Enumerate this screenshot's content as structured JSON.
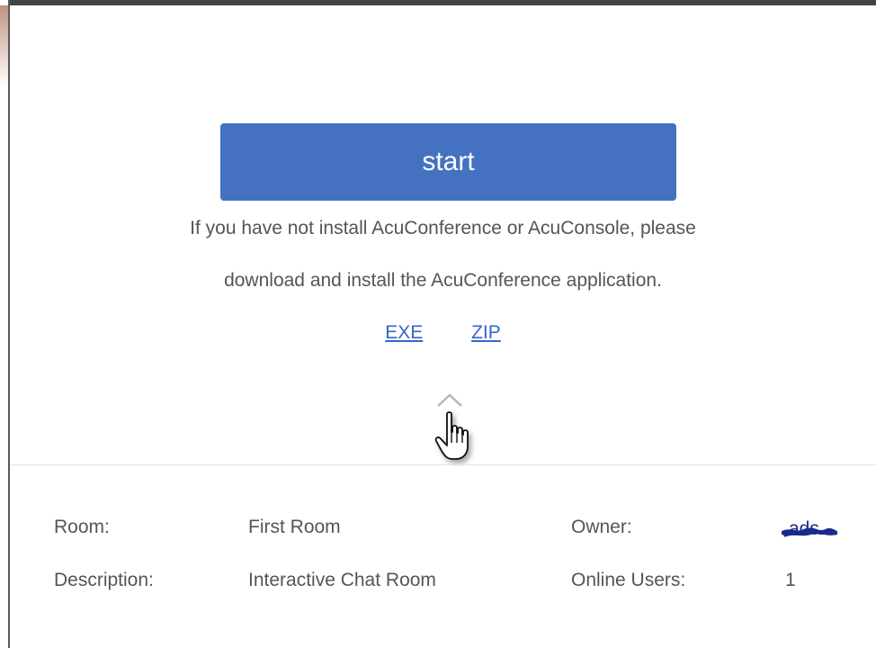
{
  "start_button": {
    "label": "start"
  },
  "info": {
    "line1": "If you have not install AcuConference or AcuConsole, please",
    "line2": "download and install the AcuConference application."
  },
  "downloads": {
    "exe_label": "EXE",
    "zip_label": "ZIP"
  },
  "room_info": {
    "room_label": "Room:",
    "room_value": "First Room",
    "owner_label": "Owner:",
    "owner_value": "ads",
    "description_label": "Description:",
    "description_value": "Interactive Chat Room",
    "online_users_label": "Online Users:",
    "online_users_value": "1"
  },
  "colors": {
    "accent_button": "#4472c0",
    "link": "#3366cc",
    "text": "#555555",
    "redaction": "#1a2a8a"
  },
  "icons": {
    "collapse": "chevron-up-icon",
    "cursor": "hand-pointer-icon"
  }
}
